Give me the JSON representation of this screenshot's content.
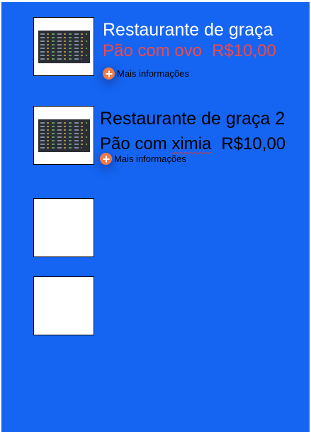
{
  "colors": {
    "background": "#1565f2",
    "title_first": "#ffffff",
    "price_first": "#f24848",
    "text_second": "#000000",
    "more_icon": "#f07a4a"
  },
  "items": [
    {
      "title": "Restaurante de graça",
      "product": "Pão com ovo",
      "price": "R$10,00",
      "more_label": "Mais informações",
      "icon": "plus-circle-icon",
      "thumbnail": "screenshot-thumbnail"
    },
    {
      "title": "Restaurante de graça 2",
      "product_prefix": "Pão com ",
      "product_misspelled": "ximia",
      "price": "R$10,00",
      "more_label": "Mais informações",
      "icon": "plus-circle-icon",
      "thumbnail": "screenshot-thumbnail"
    },
    {
      "thumbnail": "empty-thumbnail"
    },
    {
      "thumbnail": "empty-thumbnail"
    }
  ]
}
